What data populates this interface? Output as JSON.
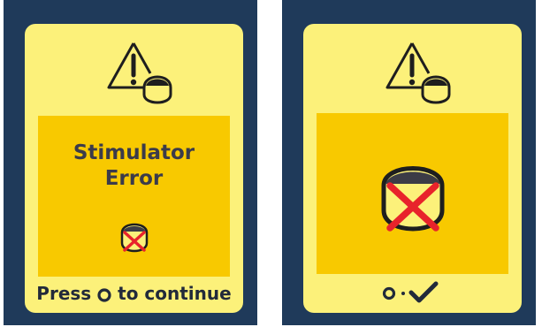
{
  "screens": [
    {
      "panel_title_line1": "Stimulator",
      "panel_title_line2": "Error",
      "footer_press": "Press",
      "footer_continue": "to continue"
    },
    {}
  ],
  "icons": {
    "warning": "warning-triangle-icon",
    "stimulator": "stimulator-icon",
    "disconnected": "stimulator-disconnected-icon",
    "button": "button-dot-icon",
    "check": "checkmark-icon"
  },
  "colors": {
    "device_frame": "#1f3a5a",
    "screen": "#fcf17a",
    "panel": "#f8c900",
    "error_x": "#e8232b",
    "text": "#3b3b4a"
  }
}
